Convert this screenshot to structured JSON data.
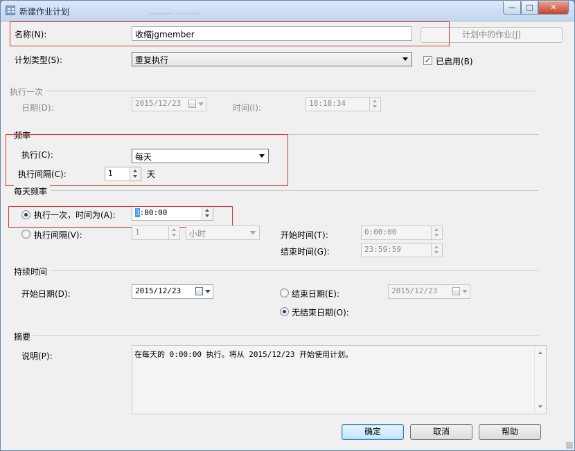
{
  "window": {
    "title": "新建作业计划",
    "ghost_title": "_______  __  ____",
    "minimize_glyph": "—",
    "maximize_glyph": "□",
    "close_glyph": "✕"
  },
  "name": {
    "label": "名称(N):",
    "value": "收缩jgmember",
    "jobs_button": "计划中的作业(J)"
  },
  "schedule_type": {
    "label": "计划类型(S):",
    "value": "重复执行",
    "enabled_label": "已启用(B)",
    "enabled_checked": true,
    "check_glyph": "✓"
  },
  "one_time": {
    "section": "执行一次",
    "date_label": "日期(D):",
    "date_value": "2015/12/23",
    "time_label": "时间(I):",
    "time_value": "18:18:34"
  },
  "frequency": {
    "section": "频率",
    "occurs_label": "执行(C):",
    "occurs_value": "每天",
    "recurs_label": "执行间隔(C):",
    "recurs_value": "1",
    "recurs_unit": "天"
  },
  "daily": {
    "section": "每天频率",
    "once_label": "执行一次，时间为(A):",
    "once_checked": true,
    "once_time_hour": "3",
    "once_time_rest": ":00:00",
    "every_label": "执行间隔(V):",
    "every_value": "1",
    "every_unit": "小时",
    "start_label": "开始时间(T):",
    "start_value": "0:00:00",
    "end_label": "结束时间(G):",
    "end_value": "23:59:59"
  },
  "duration": {
    "section": "持续时间",
    "start_label": "开始日期(D):",
    "start_value": "2015/12/23",
    "end_label": "结束日期(E):",
    "end_value": "2015/12/23",
    "no_end_label": "无结束日期(O):",
    "no_end_checked": true
  },
  "summary": {
    "section": "摘要",
    "desc_label": "说明(P):",
    "desc_value": "在每天的 0:00:00 执行。将从 2015/12/23 开始使用计划。"
  },
  "buttons": {
    "ok": "确定",
    "cancel": "取消",
    "help": "帮助"
  },
  "colors": {
    "highlight_box": "#e03030",
    "title_gradient": "#dbe8f7",
    "close_button": "#c7432a"
  }
}
